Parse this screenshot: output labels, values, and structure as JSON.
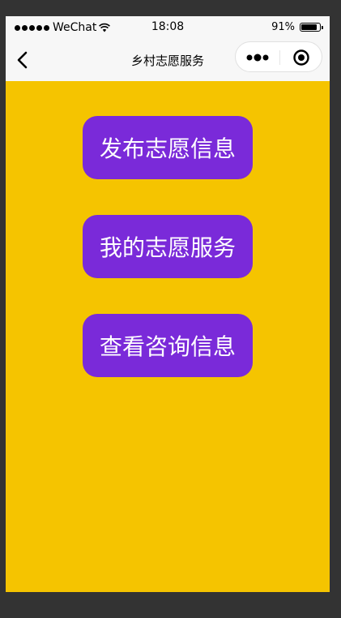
{
  "status_bar": {
    "carrier": "WeChat",
    "time": "18:08",
    "battery_percent": "91%",
    "battery_level": 0.91
  },
  "nav": {
    "title": "乡村志愿服务",
    "back_icon": "chevron-left-icon",
    "more_icon": "more-dots-icon",
    "close_icon": "target-circle-icon"
  },
  "actions": [
    {
      "label": "发布志愿信息"
    },
    {
      "label": "我的志愿服务"
    },
    {
      "label": "查看咨询信息"
    }
  ],
  "colors": {
    "background": "#f5c400",
    "button": "#7a2ad9",
    "button_text": "#ffffff",
    "bar": "#f7f7f7"
  }
}
